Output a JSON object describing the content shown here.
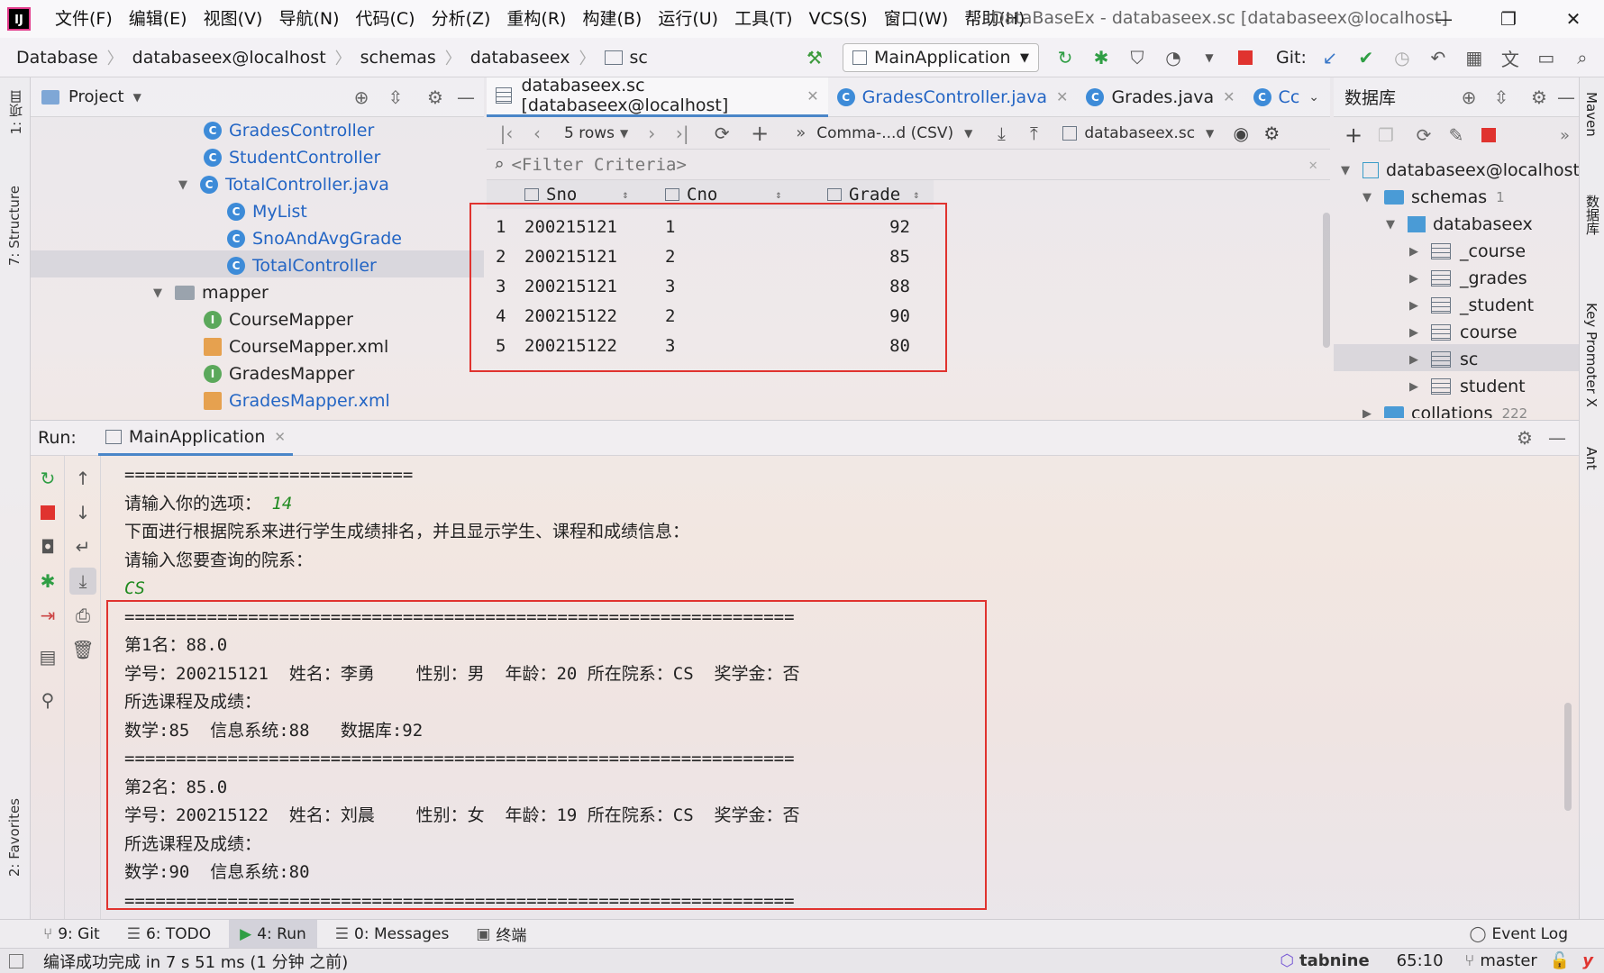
{
  "app": {
    "logo": "IJ",
    "window_title": "DataBaseEx - databaseex.sc [databaseex@localhost]"
  },
  "menu": [
    "文件(F)",
    "编辑(E)",
    "视图(V)",
    "导航(N)",
    "代码(C)",
    "分析(Z)",
    "重构(R)",
    "构建(B)",
    "运行(U)",
    "工具(T)",
    "VCS(S)",
    "窗口(W)",
    "帮助(H)"
  ],
  "breadcrumb": [
    "Database",
    "databaseex@localhost",
    "schemas",
    "databaseex",
    "sc"
  ],
  "toolbar": {
    "run_config": "MainApplication",
    "git_label": "Git:"
  },
  "left_tools": {
    "project": "1: 项目",
    "structure": "7: Structure",
    "favorites": "2: Favorites"
  },
  "project": {
    "title": "Project",
    "tree": [
      {
        "label": "GradesController",
        "type": "class",
        "color": "blue"
      },
      {
        "label": "StudentController",
        "type": "class",
        "color": "blue"
      },
      {
        "label": "TotalController.java",
        "type": "class",
        "color": "blue",
        "expanded": true
      },
      {
        "label": "MyList",
        "type": "class",
        "color": "blue"
      },
      {
        "label": "SnoAndAvgGrade",
        "type": "class",
        "color": "blue"
      },
      {
        "label": "TotalController",
        "type": "class",
        "color": "blue",
        "selected": true
      },
      {
        "label": "mapper",
        "type": "folder",
        "color": "black",
        "expanded": true
      },
      {
        "label": "CourseMapper",
        "type": "interface",
        "color": "black"
      },
      {
        "label": "CourseMapper.xml",
        "type": "xml",
        "color": "black"
      },
      {
        "label": "GradesMapper",
        "type": "interface",
        "color": "black"
      },
      {
        "label": "GradesMapper.xml",
        "type": "xml",
        "color": "blue"
      }
    ]
  },
  "editor_tabs": [
    {
      "label": "databaseex.sc [databaseex@localhost]",
      "active": true
    },
    {
      "label": "GradesController.java"
    },
    {
      "label": "Grades.java"
    },
    {
      "label": "Cc"
    }
  ],
  "grid_toolbar": {
    "rows": "5 rows",
    "export_format": "Comma-...d (CSV)",
    "target": "databaseex.sc"
  },
  "filter_placeholder": "<Filter Criteria>",
  "table": {
    "columns": [
      "Sno",
      "Cno",
      "Grade"
    ],
    "rows": [
      [
        "1",
        "200215121",
        "1",
        "92"
      ],
      [
        "2",
        "200215121",
        "2",
        "85"
      ],
      [
        "3",
        "200215121",
        "3",
        "88"
      ],
      [
        "4",
        "200215122",
        "2",
        "90"
      ],
      [
        "5",
        "200215122",
        "3",
        "80"
      ]
    ]
  },
  "db_panel": {
    "title": "数据库",
    "tree": [
      {
        "label": "databaseex@localhost",
        "level": 0
      },
      {
        "label": "schemas",
        "count": "1",
        "level": 1
      },
      {
        "label": "databaseex",
        "level": 2
      },
      {
        "label": "_course",
        "level": 3
      },
      {
        "label": "_grades",
        "level": 3
      },
      {
        "label": "_student",
        "level": 3
      },
      {
        "label": "course",
        "level": 3
      },
      {
        "label": "sc",
        "level": 3,
        "selected": true
      },
      {
        "label": "student",
        "level": 3
      },
      {
        "label": "collations",
        "count": "222",
        "level": 1
      }
    ]
  },
  "right_tools": [
    "Maven",
    "数据库",
    "Key Promoter X",
    "Ant"
  ],
  "run": {
    "label": "Run:",
    "tab": "MainApplication",
    "console": [
      {
        "text": "============================",
        "cls": ""
      },
      {
        "text": "请输入你的选项： ",
        "input": "14"
      },
      {
        "text": "下面进行根据院系来进行学生成绩排名，并且显示学生、课程和成绩信息：",
        "cls": ""
      },
      {
        "text": "请输入您要查询的院系：",
        "cls": ""
      },
      {
        "text": "",
        "input": "CS"
      },
      {
        "text": "=================================================================",
        "cls": ""
      },
      {
        "text": "第1名：88.0",
        "cls": ""
      },
      {
        "text": "学号：200215121  姓名：李勇    性别：男  年龄：20 所在院系：CS  奖学金：否",
        "cls": ""
      },
      {
        "text": "所选课程及成绩：",
        "cls": ""
      },
      {
        "text": "数学:85  信息系统:88   数据库:92",
        "cls": ""
      },
      {
        "text": "=================================================================",
        "cls": ""
      },
      {
        "text": "第2名：85.0",
        "cls": ""
      },
      {
        "text": "学号：200215122  姓名：刘晨    性别：女  年龄：19 所在院系：CS  奖学金：否",
        "cls": ""
      },
      {
        "text": "所选课程及成绩：",
        "cls": ""
      },
      {
        "text": "数学:90  信息系统:80",
        "cls": ""
      },
      {
        "text": "=================================================================",
        "cls": ""
      }
    ]
  },
  "bottom_tabs": [
    "9: Git",
    "6: TODO",
    "4: Run",
    "0: Messages",
    "终端"
  ],
  "event_log": "Event Log",
  "status": {
    "message": "编译成功完成 in 7 s 51 ms (1 分钟 之前)",
    "brand": "tabnine",
    "position": "65:10",
    "branch": "master"
  },
  "colors": {
    "accent": "#4a86c8",
    "highlight_box": "#e0332f",
    "class_blue": "#2365c4"
  }
}
